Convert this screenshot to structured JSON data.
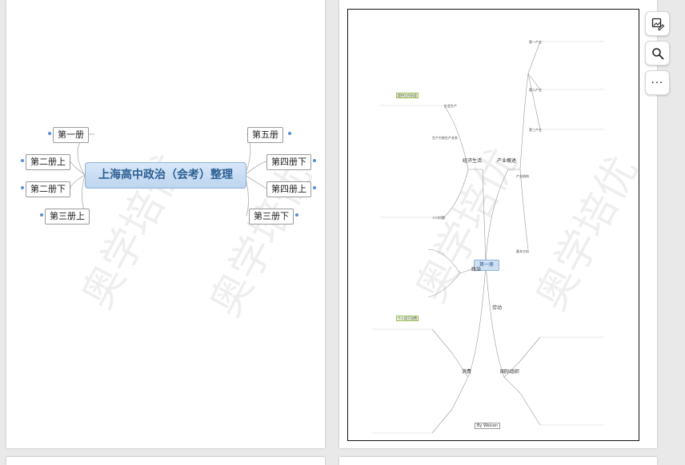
{
  "left_page": {
    "central_topic": "上海高中政治（会考）整理",
    "branches_left": [
      "第一册",
      "第二册上",
      "第二册下",
      "第三册上"
    ],
    "branches_right": [
      "第五册",
      "第四册下",
      "第四册上",
      "第三册下"
    ],
    "watermark": "奥学培优"
  },
  "right_page": {
    "watermark": "奥学培优",
    "center_topic": "第一册",
    "signature": "By Weicen",
    "main_branches": [
      "经济生活",
      "产业概述",
      "政治",
      "国际组织",
      "消费",
      "劳动"
    ],
    "sample_nodes": [
      "第一产业",
      "第二产业",
      "第三产业",
      "产业结构",
      "基本方向",
      "社会生产",
      "生产力和生产关系",
      "个人用于消费",
      "提供工作机会",
      "人口问题"
    ]
  },
  "toolbar": {
    "buttons": [
      {
        "name": "image-edit",
        "icon": "image-edit-icon"
      },
      {
        "name": "search",
        "icon": "search-icon"
      },
      {
        "name": "more",
        "icon": "more-icon",
        "label": "..."
      }
    ]
  }
}
